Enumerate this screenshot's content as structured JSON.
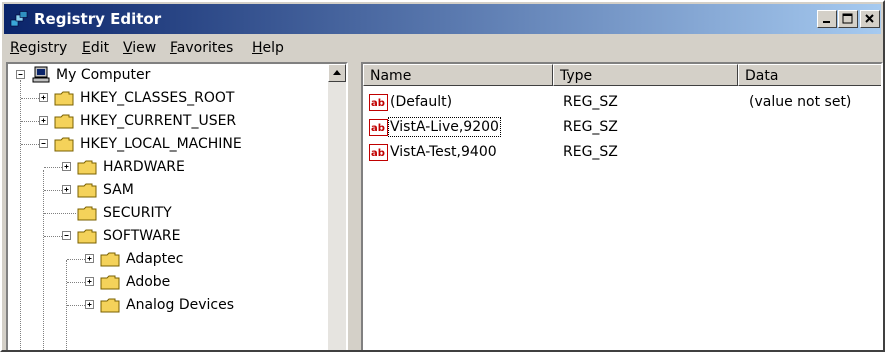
{
  "window": {
    "title": "Registry Editor"
  },
  "menubar": {
    "items": [
      {
        "label": "Registry",
        "mnemonic": "R",
        "rest": "egistry"
      },
      {
        "label": "Edit",
        "mnemonic": "E",
        "rest": "dit"
      },
      {
        "label": "View",
        "mnemonic": "V",
        "rest": "iew"
      },
      {
        "label": "Favorites",
        "mnemonic": "F",
        "rest": "avorites"
      },
      {
        "label": "Help",
        "mnemonic": "H",
        "rest": "elp"
      }
    ]
  },
  "tree": {
    "root": "My Computer",
    "nodes": [
      {
        "label": "HKEY_CLASSES_ROOT",
        "expander": "plus"
      },
      {
        "label": "HKEY_CURRENT_USER",
        "expander": "plus"
      },
      {
        "label": "HKEY_LOCAL_MACHINE",
        "expander": "minus"
      },
      {
        "label": "HARDWARE",
        "expander": "plus"
      },
      {
        "label": "SAM",
        "expander": "plus"
      },
      {
        "label": "SECURITY",
        "expander": "none"
      },
      {
        "label": "SOFTWARE",
        "expander": "minus"
      },
      {
        "label": "Adaptec",
        "expander": "plus"
      },
      {
        "label": "Adobe",
        "expander": "plus"
      },
      {
        "label": "Analog Devices",
        "expander": "plus"
      }
    ]
  },
  "list": {
    "columns": [
      "Name",
      "Type",
      "Data"
    ],
    "rows": [
      {
        "name": "(Default)",
        "type": "REG_SZ",
        "data": "(value not set)"
      },
      {
        "name": "VistA-Live,9200",
        "type": "REG_SZ",
        "data": ""
      },
      {
        "name": "VistA-Test,9400",
        "type": "REG_SZ",
        "data": ""
      }
    ]
  },
  "colors": {
    "titlebar_start": "#0a246a",
    "titlebar_end": "#a6caf0",
    "chrome": "#d4d0c8",
    "folder": "#f4d25a",
    "value_icon_red": "#c00000"
  }
}
